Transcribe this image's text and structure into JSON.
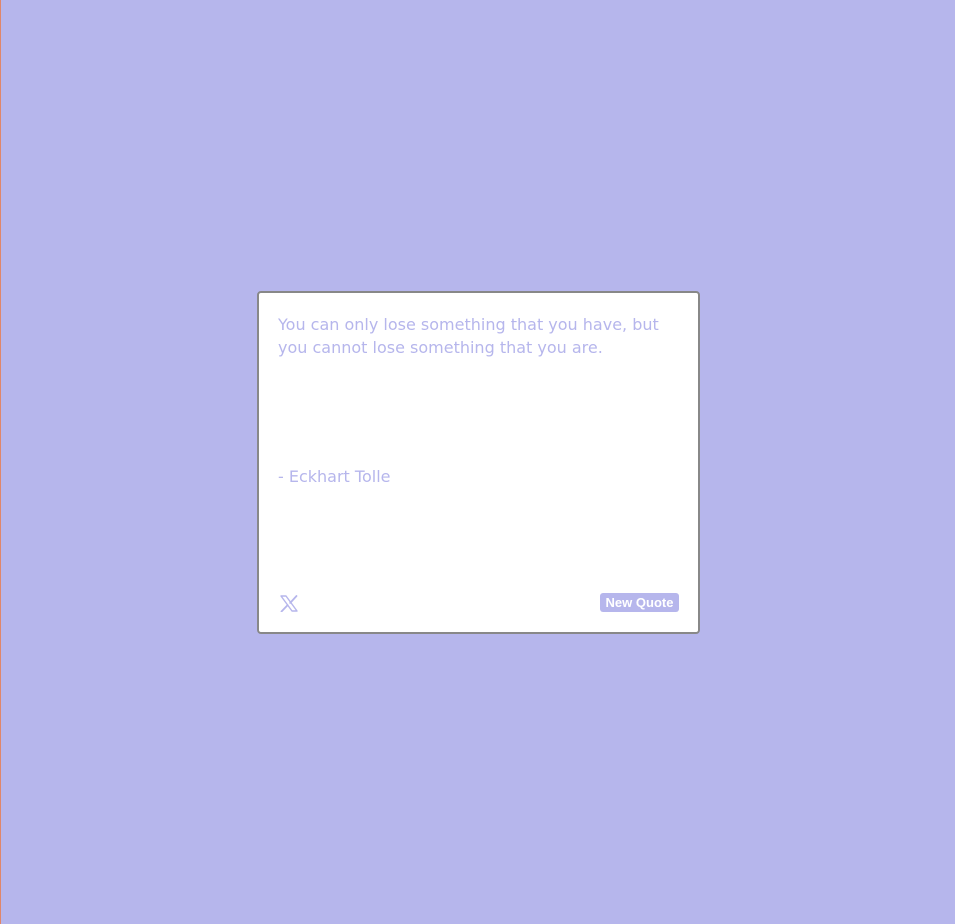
{
  "theme": {
    "background": "#b6b6ec",
    "card_background": "#ffffff",
    "accent": "#b6b6ec",
    "card_border": "#888888",
    "left_edge_line": "#e0866a"
  },
  "quote": {
    "text": "You can only lose something that you have, but you cannot lose something that you are.",
    "author": "- Eckhart Tolle"
  },
  "actions": {
    "tweet_icon": "x-logo-icon",
    "new_quote_label": "New Quote"
  }
}
